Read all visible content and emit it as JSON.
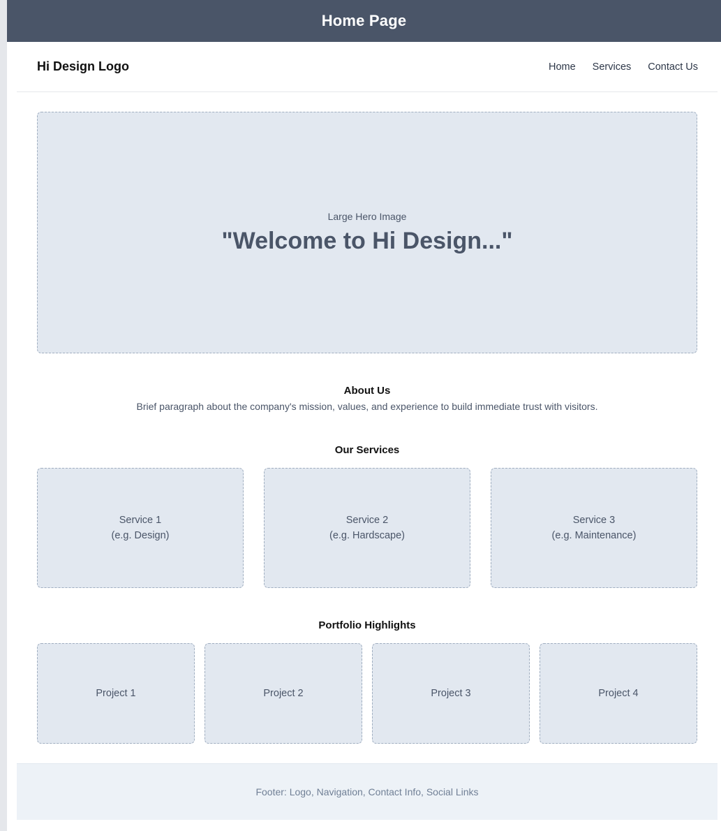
{
  "window": {
    "title": "Home Page"
  },
  "header": {
    "logo": "Hi Design Logo",
    "nav": [
      {
        "label": "Home"
      },
      {
        "label": "Services"
      },
      {
        "label": "Contact Us"
      }
    ]
  },
  "hero": {
    "label": "Large Hero Image",
    "headline": "\"Welcome to Hi Design...\""
  },
  "about": {
    "title": "About Us",
    "text": "Brief paragraph about the company's mission, values, and experience to build immediate trust with visitors."
  },
  "services": {
    "title": "Our Services",
    "items": [
      {
        "name": "Service 1",
        "example": "(e.g. Design)"
      },
      {
        "name": "Service 2",
        "example": "(e.g. Hardscape)"
      },
      {
        "name": "Service 3",
        "example": "(e.g. Maintenance)"
      }
    ]
  },
  "portfolio": {
    "title": "Portfolio Highlights",
    "items": [
      {
        "label": "Project 1"
      },
      {
        "label": "Project 2"
      },
      {
        "label": "Project 3"
      },
      {
        "label": "Project 4"
      }
    ]
  },
  "footer": {
    "text": "Footer: Logo, Navigation, Contact Info, Social Links"
  },
  "colors": {
    "title_bar": "#4a5568",
    "placeholder_bg": "#e2e8f0",
    "footer_bg": "#edf2f7"
  }
}
